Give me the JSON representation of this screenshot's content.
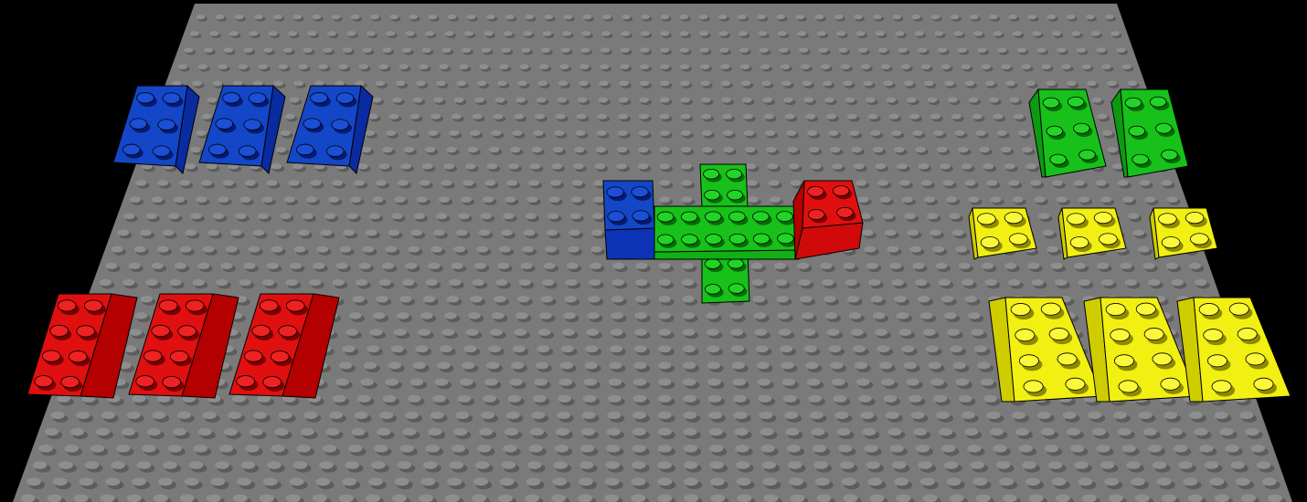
{
  "scene": {
    "background_color": "#000000",
    "baseplate": {
      "color": "#7a7a7a",
      "stud_color": "#8e8e8e",
      "stud_shadow_color": "#5c5c5c",
      "stud_columns": 48,
      "stud_rows": 30
    },
    "palette": {
      "blue": {
        "top": "#1447c7",
        "side": "#0a2aa0",
        "front": "#0c33b6",
        "stud": "#1a4fd6",
        "shadow": "#061a72",
        "edge": "#000000"
      },
      "red": {
        "top": "#e01010",
        "side": "#b40000",
        "front": "#d00a0a",
        "stud": "#ee2222",
        "shadow": "#7a0000",
        "edge": "#000000"
      },
      "green": {
        "top": "#17c11a",
        "side": "#0c9a10",
        "front": "#12b015",
        "stud": "#22d426",
        "shadow": "#066a08",
        "edge": "#000000"
      },
      "yellow": {
        "top": "#f2ef12",
        "side": "#cfcc00",
        "front": "#e6e300",
        "stud": "#fbf83a",
        "shadow": "#8c8a00",
        "edge": "#000000"
      }
    },
    "bricks": [
      {
        "id": "blue-brick-1",
        "color": "blue",
        "size": "2x3"
      },
      {
        "id": "blue-brick-2",
        "color": "blue",
        "size": "2x3"
      },
      {
        "id": "blue-brick-3",
        "color": "blue",
        "size": "2x3"
      },
      {
        "id": "red-brick-1",
        "color": "red",
        "size": "2x4"
      },
      {
        "id": "red-brick-2",
        "color": "red",
        "size": "2x4"
      },
      {
        "id": "red-brick-3",
        "color": "red",
        "size": "2x4"
      },
      {
        "id": "green-brick-1",
        "color": "green",
        "size": "2x3"
      },
      {
        "id": "green-brick-2",
        "color": "green",
        "size": "2x3"
      },
      {
        "id": "yellow-brick-1",
        "color": "yellow",
        "size": "2x2"
      },
      {
        "id": "yellow-brick-2",
        "color": "yellow",
        "size": "2x2"
      },
      {
        "id": "yellow-brick-3",
        "color": "yellow",
        "size": "2x2"
      },
      {
        "id": "yellow-brick-4",
        "color": "yellow",
        "size": "2x4"
      },
      {
        "id": "yellow-brick-5",
        "color": "yellow",
        "size": "2x4"
      },
      {
        "id": "yellow-brick-6",
        "color": "yellow",
        "size": "2x4"
      }
    ],
    "assembly": [
      {
        "id": "assembly-blue",
        "color": "blue",
        "size": "2x2"
      },
      {
        "id": "assembly-green-top",
        "color": "green",
        "size": "2x2"
      },
      {
        "id": "assembly-green-center",
        "color": "green",
        "size": "2x6"
      },
      {
        "id": "assembly-green-bottom",
        "color": "green",
        "size": "2x2"
      },
      {
        "id": "assembly-red",
        "color": "red",
        "size": "2x2"
      }
    ]
  }
}
